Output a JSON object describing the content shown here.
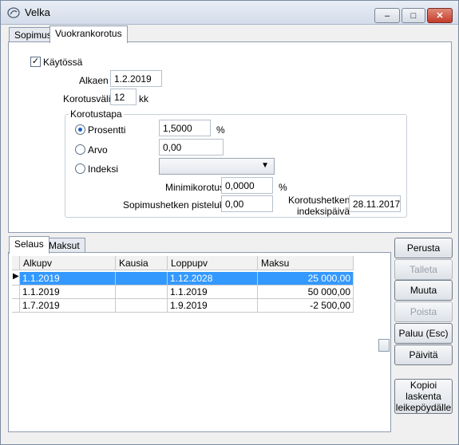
{
  "window": {
    "title": "Velka",
    "min_label": "–",
    "max_label": "□",
    "close_label": "✕"
  },
  "top_tabs": [
    {
      "label": "Sopimus"
    },
    {
      "label": "Vuokrankorotus"
    }
  ],
  "form": {
    "enabled_label": "Käytössä",
    "enabled_check": "✓",
    "start_label": "Alkaen",
    "start_value": "1.2.2019",
    "interval_label": "Korotusväli",
    "interval_value": "12",
    "interval_unit": "kk",
    "method_group_label": "Korotustapa",
    "percent_label": "Prosentti",
    "percent_value": "1,5000",
    "percent_unit": "%",
    "value_label": "Arvo",
    "value_value": "0,00",
    "index_label": "Indeksi",
    "index_value": "",
    "min_label": "Minimikorotus",
    "min_value": "0,0000",
    "min_unit": "%",
    "points_label": "Sopimushetken pisteluku",
    "points_value": "0,00",
    "index_date_label_1": "Korotushetken",
    "index_date_label_2": "indeksipäivä",
    "index_date_value": "28.11.2017"
  },
  "bottom_tabs": [
    {
      "label": "Selaus"
    },
    {
      "label": "Maksut"
    }
  ],
  "table": {
    "columns": [
      "Alkupv",
      "Kausia",
      "Loppupv",
      "Maksu"
    ],
    "rows": [
      {
        "alkupv": "1.1.2019",
        "kausia": "",
        "loppupv": "1.12.2028",
        "maksu": "25 000,00"
      },
      {
        "alkupv": "1.1.2019",
        "kausia": "",
        "loppupv": "1.1.2019",
        "maksu": "50 000,00"
      },
      {
        "alkupv": "1.7.2019",
        "kausia": "",
        "loppupv": "1.9.2019",
        "maksu": "-2 500,00"
      }
    ],
    "selected_row": 0
  },
  "buttons": {
    "perusta": "Perusta",
    "talleta": "Talleta",
    "muuta": "Muuta",
    "poista": "Poista",
    "paluu": "Paluu (Esc)",
    "paivita": "Päivitä",
    "kopioi_1": "Kopioi",
    "kopioi_2": "laskenta",
    "kopioi_3": "leikepöydälle"
  },
  "icons": {
    "app": "app-icon",
    "dropdown": "chevron-down-icon",
    "row_pointer": "row-pointer-icon"
  }
}
